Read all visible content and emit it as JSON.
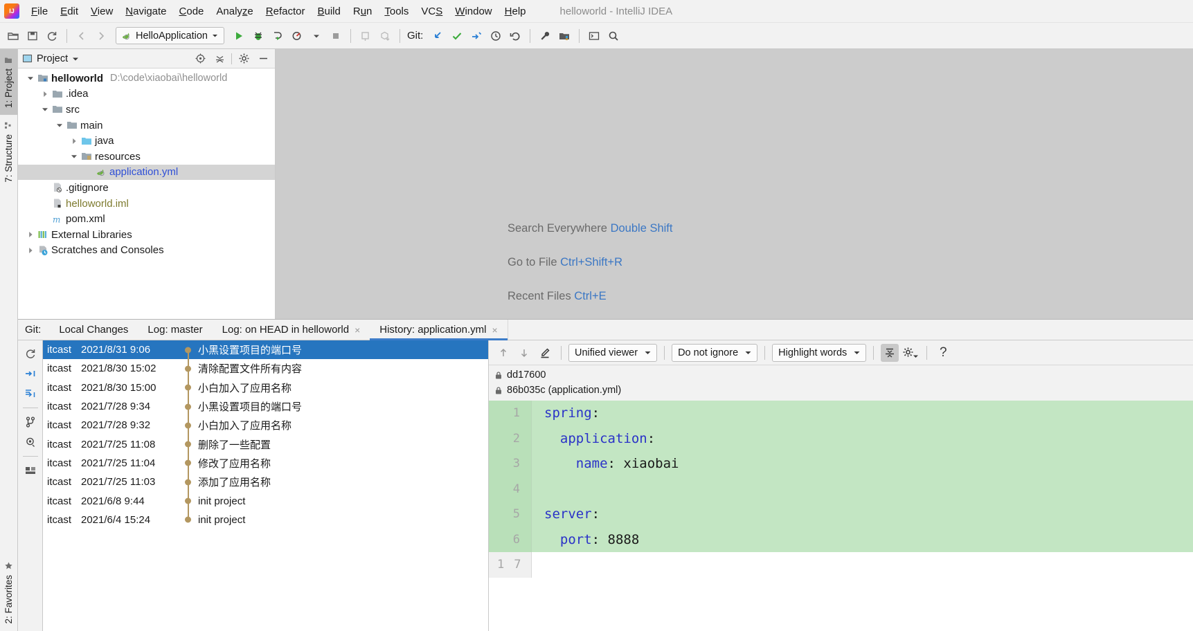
{
  "window": {
    "title": "helloworld - IntelliJ IDEA"
  },
  "menubar": {
    "items": [
      {
        "label": "File",
        "mnemonic": "F"
      },
      {
        "label": "Edit",
        "mnemonic": "E"
      },
      {
        "label": "View",
        "mnemonic": "V"
      },
      {
        "label": "Navigate",
        "mnemonic": "N"
      },
      {
        "label": "Code",
        "mnemonic": "C"
      },
      {
        "label": "Analyze",
        "mnemonic": "z"
      },
      {
        "label": "Refactor",
        "mnemonic": "R"
      },
      {
        "label": "Build",
        "mnemonic": "B"
      },
      {
        "label": "Run",
        "mnemonic": "u"
      },
      {
        "label": "Tools",
        "mnemonic": "T"
      },
      {
        "label": "VCS",
        "mnemonic": "S"
      },
      {
        "label": "Window",
        "mnemonic": "W"
      },
      {
        "label": "Help",
        "mnemonic": "H"
      }
    ]
  },
  "toolbar": {
    "open_icon": "open-folder-icon",
    "save_icon": "save-icon",
    "sync_icon": "sync-icon",
    "back_icon": "arrow-left-icon",
    "forward_icon": "arrow-right-icon",
    "run_config": "HelloApplication",
    "run_icon": "run-icon",
    "debug_icon": "debug-icon",
    "run_with_coverage_icon": "run-coverage-icon",
    "profile_icon": "profiler-icon",
    "stop_icon": "stop-icon",
    "git_label": "Git:",
    "update_icon": "update-project-icon",
    "commit_icon": "commit-checkmark-icon",
    "push_icon": "push-icon",
    "history_icon": "history-clock-icon",
    "rollback_icon": "rollback-icon",
    "settings_icon": "wrench-icon",
    "project_structure_icon": "project-structure-icon",
    "terminal_icon": "terminal-icon",
    "search_icon": "search-icon"
  },
  "left_strip": {
    "project_tab": "1: Project",
    "structure_tab": "7: Structure",
    "favorites_tab": "2: Favorites"
  },
  "project_panel": {
    "title": "Project",
    "locate_icon": "crosshair-locate-icon",
    "collapse_icon": "collapse-all-icon",
    "settings_icon": "gear-icon",
    "hide_icon": "minimize-icon",
    "tree": [
      {
        "label": "helloworld",
        "path": "D:\\code\\xiaobai\\helloworld",
        "indent": 0,
        "arrow": "down",
        "icon": "module-icon",
        "bold": true,
        "style": "plain"
      },
      {
        "label": ".idea",
        "indent": 1,
        "arrow": "right",
        "icon": "folder-icon",
        "style": "plain"
      },
      {
        "label": "src",
        "indent": 1,
        "arrow": "down",
        "icon": "folder-icon",
        "style": "plain"
      },
      {
        "label": "main",
        "indent": 2,
        "arrow": "down",
        "icon": "folder-icon",
        "style": "plain"
      },
      {
        "label": "java",
        "indent": 3,
        "arrow": "right",
        "icon": "source-folder-icon",
        "style": "plain"
      },
      {
        "label": "resources",
        "indent": 3,
        "arrow": "down",
        "icon": "resources-folder-icon",
        "style": "plain"
      },
      {
        "label": "application.yml",
        "indent": 4,
        "arrow": "none",
        "icon": "yaml-file-icon",
        "style": "blue",
        "selected": true
      },
      {
        "label": ".gitignore",
        "indent": 1,
        "arrow": "none",
        "icon": "gitignore-file-icon",
        "style": "plain"
      },
      {
        "label": "helloworld.iml",
        "indent": 1,
        "arrow": "none",
        "icon": "iml-file-icon",
        "style": "olive"
      },
      {
        "label": "pom.xml",
        "indent": 1,
        "arrow": "none",
        "icon": "maven-file-icon",
        "style": "plain"
      },
      {
        "label": "External Libraries",
        "indent": 0,
        "arrow": "right",
        "icon": "libraries-icon",
        "style": "plain"
      },
      {
        "label": "Scratches and Consoles",
        "indent": 0,
        "arrow": "right",
        "icon": "scratches-icon",
        "style": "plain"
      }
    ]
  },
  "editor_hints": [
    {
      "action": "Search Everywhere",
      "shortcut": "Double Shift"
    },
    {
      "action": "Go to File",
      "shortcut": "Ctrl+Shift+R"
    },
    {
      "action": "Recent Files",
      "shortcut": "Ctrl+E"
    }
  ],
  "git_window": {
    "label": "Git:",
    "tabs": [
      {
        "label": "Local Changes",
        "closable": false,
        "active": false
      },
      {
        "label": "Log: master",
        "closable": false,
        "active": false
      },
      {
        "label": "Log: on HEAD in helloworld",
        "closable": true,
        "active": false
      },
      {
        "label": "History: application.yml",
        "closable": true,
        "active": true
      }
    ],
    "sidebar_icons": [
      "refresh-icon",
      "collapse-all-icon",
      "expand-all-icon",
      "branch-icon",
      "show-details-icon",
      "show-diff-icon"
    ],
    "close_symbol": "×",
    "commits": [
      {
        "author": "itcast",
        "date": "2021/8/31 9:06",
        "message": "小黑设置项目的端口号",
        "selected": true
      },
      {
        "author": "itcast",
        "date": "2021/8/30 15:02",
        "message": "清除配置文件所有内容",
        "selected": false
      },
      {
        "author": "itcast",
        "date": "2021/8/30 15:00",
        "message": "小白加入了应用名称",
        "selected": false
      },
      {
        "author": "itcast",
        "date": "2021/7/28 9:34",
        "message": "小黑设置项目的端口号",
        "selected": false
      },
      {
        "author": "itcast",
        "date": "2021/7/28 9:32",
        "message": "小白加入了应用名称",
        "selected": false
      },
      {
        "author": "itcast",
        "date": "2021/7/25 11:08",
        "message": "删除了一些配置",
        "selected": false
      },
      {
        "author": "itcast",
        "date": "2021/7/25 11:04",
        "message": "修改了应用名称",
        "selected": false
      },
      {
        "author": "itcast",
        "date": "2021/7/25 11:03",
        "message": "添加了应用名称",
        "selected": false
      },
      {
        "author": "itcast",
        "date": "2021/6/8 9:44",
        "message": "init project",
        "selected": false
      },
      {
        "author": "itcast",
        "date": "2021/6/4 15:24",
        "message": "init project",
        "selected": false
      }
    ]
  },
  "diff": {
    "prev_diff_icon": "arrow-up-icon",
    "next_diff_icon": "arrow-down-icon",
    "edit_icon": "pencil-edit-icon",
    "viewer_mode": "Unified viewer",
    "whitespace_mode": "Do not ignore",
    "highlight_mode": "Highlight words",
    "collapse_icon": "collapse-unchanged-icon",
    "settings_icon": "gear-icon",
    "help_label": "?",
    "revisions": [
      {
        "lock_icon": "lock-icon",
        "label": "dd17600"
      },
      {
        "lock_icon": "lock-icon",
        "label": "86b035c (application.yml)"
      }
    ],
    "code_lines": [
      {
        "num": "1",
        "indent": 0,
        "key": "spring",
        "value": "",
        "changed": true
      },
      {
        "num": "2",
        "indent": 2,
        "key": "application",
        "value": "",
        "changed": true
      },
      {
        "num": "3",
        "indent": 4,
        "key": "name",
        "value": " xiaobai",
        "changed": true
      },
      {
        "num": "4",
        "indent": 0,
        "key": "",
        "value": "",
        "changed": true
      },
      {
        "num": "5",
        "indent": 0,
        "key": "server",
        "value": "",
        "changed": true
      },
      {
        "num": "6",
        "indent": 2,
        "key": "port",
        "value": " 8888",
        "changed": true
      }
    ],
    "footer_numbers": [
      "1",
      "7"
    ]
  }
}
